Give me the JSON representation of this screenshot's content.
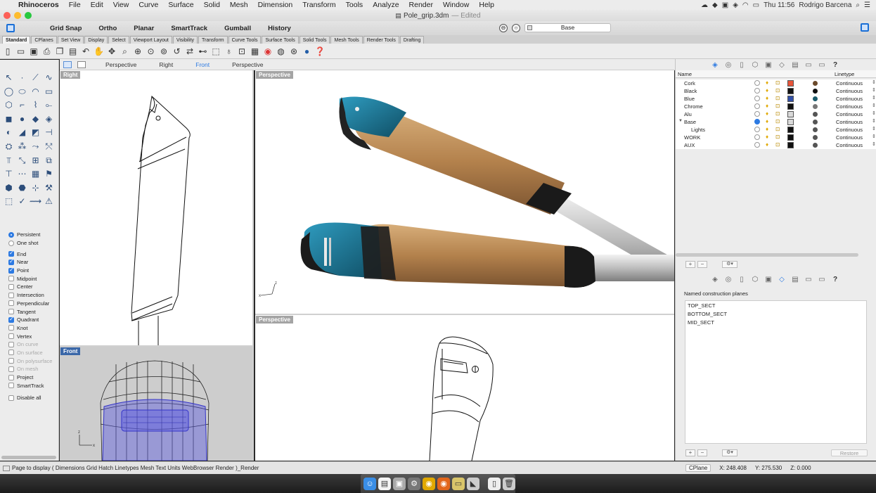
{
  "menubar": {
    "app_name": "Rhinoceros",
    "items": [
      "File",
      "Edit",
      "View",
      "Curve",
      "Surface",
      "Solid",
      "Mesh",
      "Dimension",
      "Transform",
      "Tools",
      "Analyze",
      "Render",
      "Window",
      "Help"
    ],
    "clock": "Thu 11:56",
    "user": "Rodrigo Barcena"
  },
  "window": {
    "title": "Pole_grip.3dm",
    "edited": "— Edited"
  },
  "modes": {
    "items": [
      "Grid Snap",
      "Ortho",
      "Planar",
      "SmartTrack",
      "Gumball",
      "History"
    ],
    "current_layer": "Base"
  },
  "tabs": [
    "Standard",
    "CPlanes",
    "Set View",
    "Display",
    "Select",
    "Viewport Layout",
    "Visibility",
    "Transform",
    "Curve Tools",
    "Surface Tools",
    "Solid Tools",
    "Mesh Tools",
    "Render Tools",
    "Drafting"
  ],
  "viewport_tabs": [
    "Perspective",
    "Right",
    "Front",
    "Perspective"
  ],
  "viewports": {
    "right": "Right",
    "persp1": "Perspective",
    "front": "Front",
    "persp2": "Perspective"
  },
  "osnaps": {
    "persistent": "Persistent",
    "one_shot": "One shot",
    "items": [
      {
        "label": "End",
        "checked": true,
        "disabled": false
      },
      {
        "label": "Near",
        "checked": true,
        "disabled": false
      },
      {
        "label": "Point",
        "checked": true,
        "disabled": false
      },
      {
        "label": "Midpoint",
        "checked": false,
        "disabled": false
      },
      {
        "label": "Center",
        "checked": false,
        "disabled": false
      },
      {
        "label": "Intersection",
        "checked": false,
        "disabled": false
      },
      {
        "label": "Perpendicular",
        "checked": false,
        "disabled": false
      },
      {
        "label": "Tangent",
        "checked": false,
        "disabled": false
      },
      {
        "label": "Quadrant",
        "checked": true,
        "disabled": false
      },
      {
        "label": "Knot",
        "checked": false,
        "disabled": false
      },
      {
        "label": "Vertex",
        "checked": false,
        "disabled": false
      },
      {
        "label": "On curve",
        "checked": false,
        "disabled": true
      },
      {
        "label": "On surface",
        "checked": false,
        "disabled": true
      },
      {
        "label": "On polysurface",
        "checked": false,
        "disabled": true
      },
      {
        "label": "On mesh",
        "checked": false,
        "disabled": true
      },
      {
        "label": "Project",
        "checked": false,
        "disabled": false
      },
      {
        "label": "SmartTrack",
        "checked": false,
        "disabled": false
      }
    ],
    "disable_all": "Disable all"
  },
  "layers": {
    "header_name": "Name",
    "header_linetype": "Linetype",
    "rows": [
      {
        "name": "Cork",
        "color": "#e8553a",
        "material": "#6b4a2b",
        "current": false,
        "linetype": "Continuous",
        "indent": 0
      },
      {
        "name": "Black",
        "color": "#111111",
        "material": "#111111",
        "current": false,
        "linetype": "Continuous",
        "indent": 0
      },
      {
        "name": "Blue",
        "color": "#3250a8",
        "material": "#1b5b6b",
        "current": false,
        "linetype": "Continuous",
        "indent": 0
      },
      {
        "name": "Chrome",
        "color": "#111111",
        "material": "#777777",
        "current": false,
        "linetype": "Continuous",
        "indent": 0
      },
      {
        "name": "Alu",
        "color": "#d9d9d9",
        "material": "#555555",
        "current": false,
        "linetype": "Continuous",
        "indent": 0
      },
      {
        "name": "Base",
        "color": "#d9d9d9",
        "material": "#555555",
        "current": true,
        "linetype": "Continuous",
        "indent": 0
      },
      {
        "name": "Lights",
        "color": "#111111",
        "material": "#555555",
        "current": false,
        "linetype": "Continuous",
        "indent": 1
      },
      {
        "name": "WORK",
        "color": "#111111",
        "material": "#555555",
        "current": false,
        "linetype": "Continuous",
        "indent": 0
      },
      {
        "name": "AUX",
        "color": "#111111",
        "material": "#555555",
        "current": false,
        "linetype": "Continuous",
        "indent": 0
      }
    ]
  },
  "cplanes": {
    "title": "Named construction planes",
    "items": [
      "TOP_SECT",
      "BOTTOM_SECT",
      "MID_SECT"
    ],
    "restore": "Restore"
  },
  "status": {
    "prompt": "Page to display ( Dimensions Grid Hatch Linetypes Mesh Text Units WebBrowser Render )_Render",
    "cplane": "CPlane",
    "x": "X: 248.408",
    "y": "Y: 275.530",
    "z": "Z: 0.000"
  },
  "colors": {
    "accent": "#2d7ae2",
    "cork": "#b58a5a",
    "blue_cap": "#1e7f9e"
  }
}
